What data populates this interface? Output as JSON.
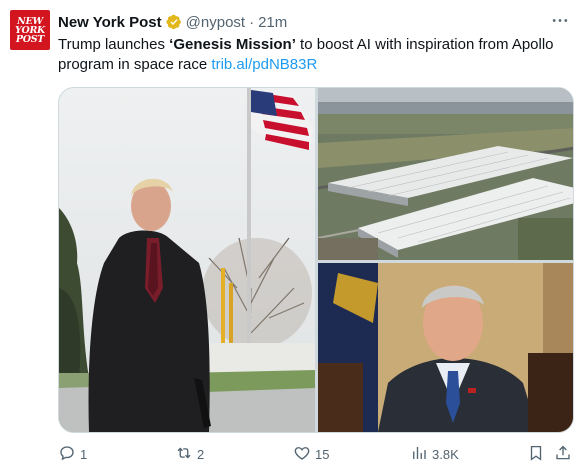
{
  "account": {
    "avatar_lines": [
      "NEW",
      "YORK",
      "POST"
    ],
    "name": "New York Post",
    "handle": "@nypost",
    "separator": "·",
    "time": "21m"
  },
  "tweet": {
    "text_part1": "Trump launches ",
    "text_quote_open": "‘",
    "text_bold": "Genesis Mission",
    "text_quote_close": "’",
    "text_part2": " to boost AI with inspiration from Apollo program in space race ",
    "link": "trib.al/pdNB83R"
  },
  "actions": {
    "replies": "1",
    "reposts": "2",
    "likes": "15",
    "views": "3.8K"
  },
  "icons": {
    "verified": "verified-badge-icon",
    "more": "more-icon",
    "reply": "reply-icon",
    "repost": "repost-icon",
    "like": "like-icon",
    "views": "views-icon",
    "bookmark": "bookmark-icon",
    "share": "share-icon"
  },
  "colors": {
    "brand_red": "#d2151f",
    "verified_gold": "#e2b719",
    "link_blue": "#1d9bf0",
    "secondary_text": "#536471"
  }
}
